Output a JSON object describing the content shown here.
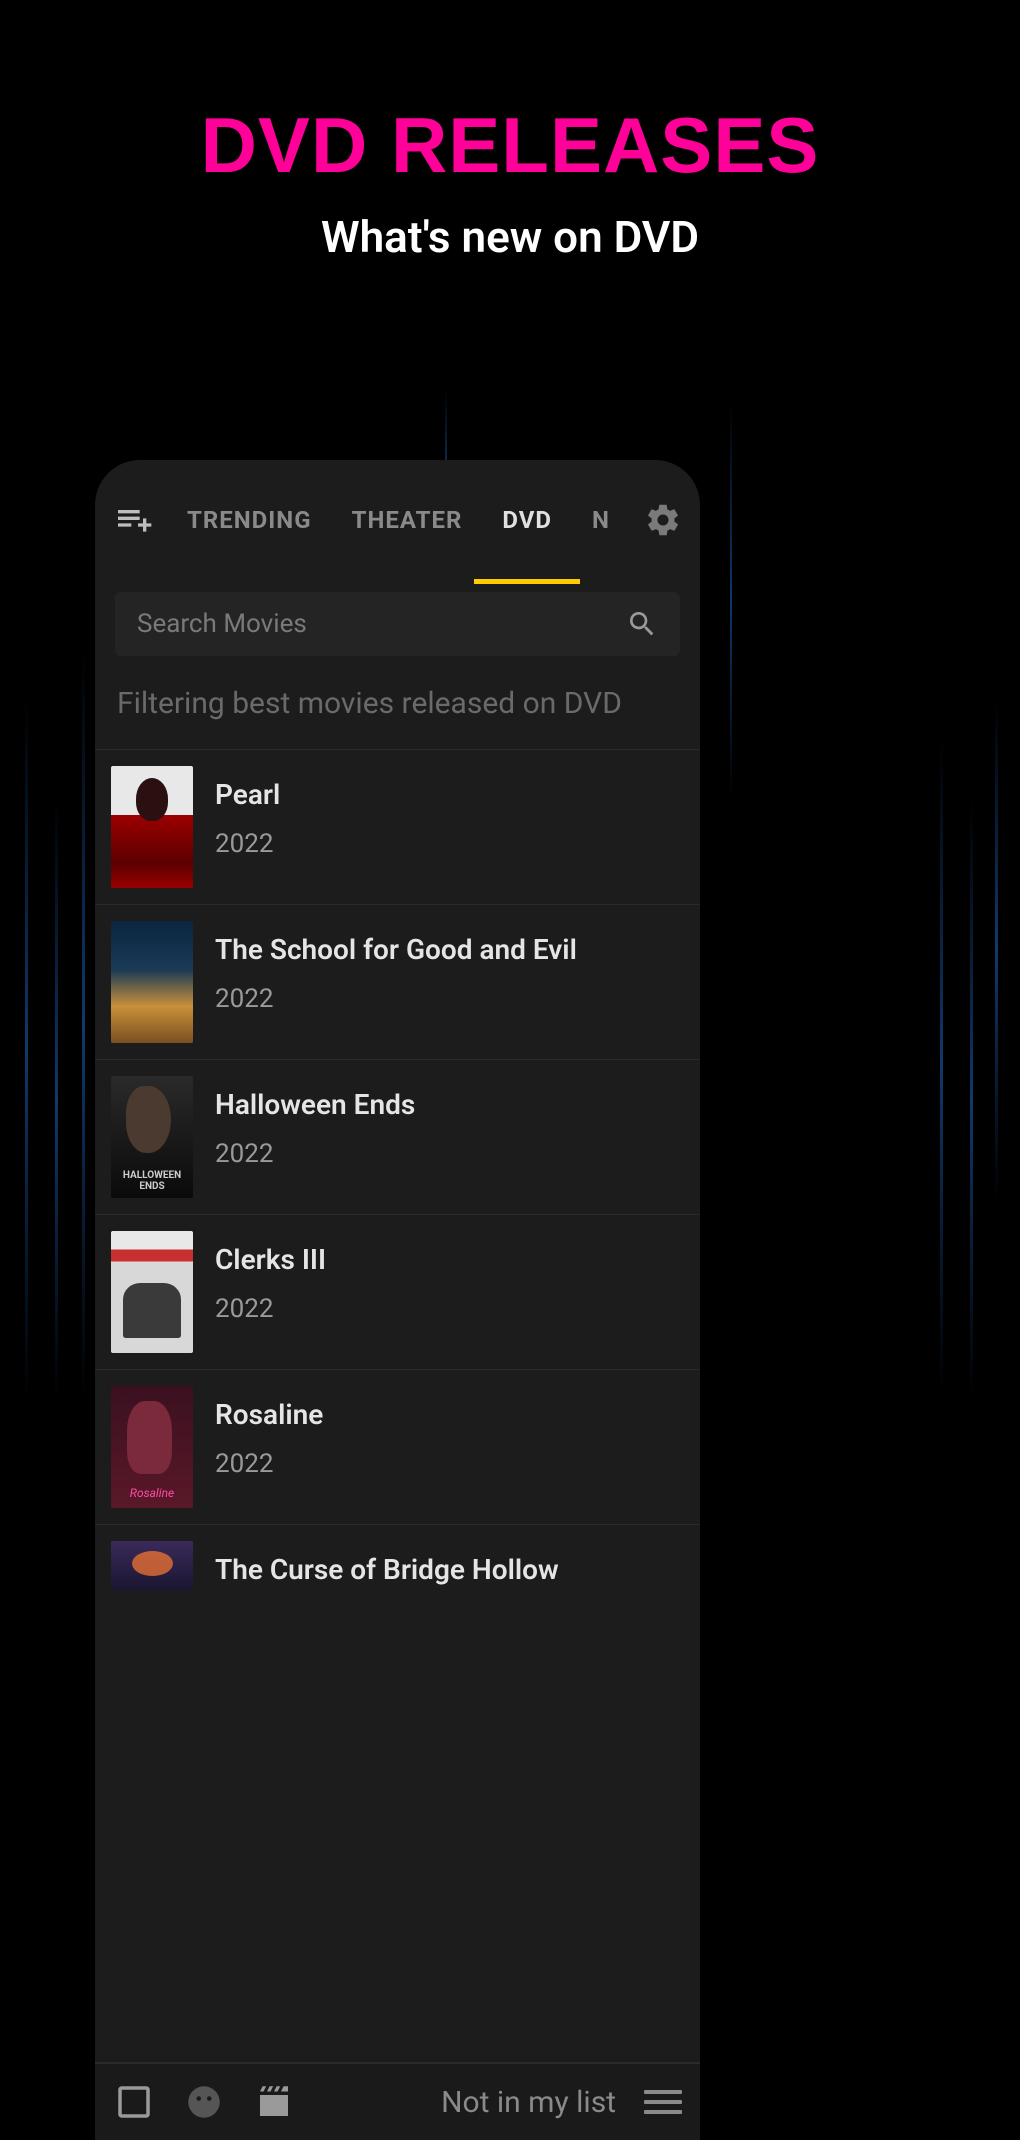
{
  "header": {
    "title": "DVD RELEASES",
    "subtitle": "What's new on DVD"
  },
  "tabs": [
    {
      "label": "TRENDING",
      "active": false
    },
    {
      "label": "THEATER",
      "active": false
    },
    {
      "label": "DVD",
      "active": true
    },
    {
      "label": "N",
      "active": false
    }
  ],
  "search": {
    "placeholder": "Search Movies"
  },
  "filter_text": "Filtering best movies released on DVD",
  "movies": [
    {
      "title": "Pearl",
      "year": "2022"
    },
    {
      "title": "The School for Good and Evil",
      "year": "2022"
    },
    {
      "title": "Halloween Ends",
      "year": "2022"
    },
    {
      "title": "Clerks III",
      "year": "2022"
    },
    {
      "title": "Rosaline",
      "year": "2022"
    },
    {
      "title": "The Curse of Bridge Hollow",
      "year": ""
    }
  ],
  "bottombar": {
    "status_label": "Not in my list"
  }
}
